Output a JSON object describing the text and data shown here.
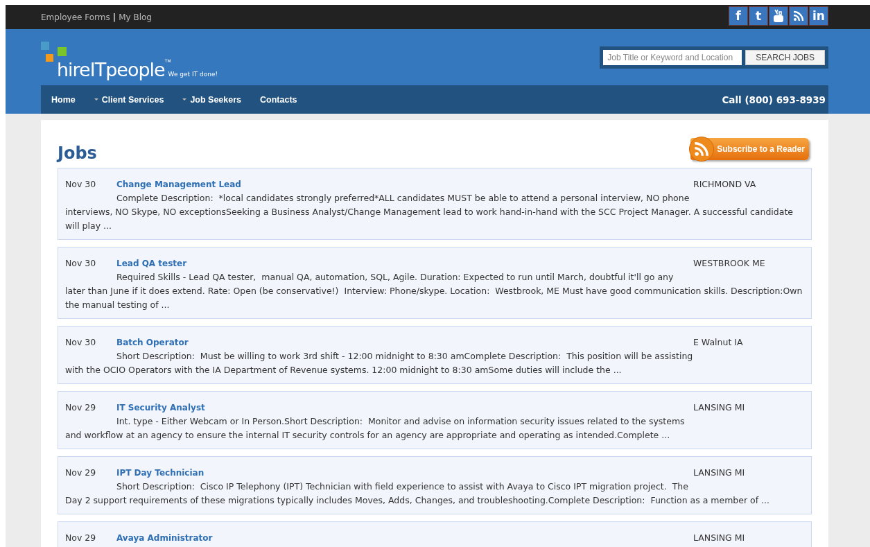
{
  "top_links": [
    {
      "label": "Employee Forms"
    },
    {
      "label": "My Blog"
    }
  ],
  "top_separator": "|",
  "social": [
    {
      "kind": "facebook",
      "label": "f"
    },
    {
      "kind": "twitter",
      "label": "t"
    },
    {
      "kind": "youtube"
    },
    {
      "kind": "rss"
    },
    {
      "kind": "linkedin",
      "label": "in"
    }
  ],
  "logo": {
    "name": "hireITpeople",
    "trademark": "TM",
    "tagline": "We get IT done!"
  },
  "search": {
    "placeholder": "Job Title or Keyword and Location",
    "button": "SEARCH JOBS"
  },
  "nav": [
    {
      "label": "Home",
      "dropdown": false
    },
    {
      "label": "Client Services",
      "dropdown": true
    },
    {
      "label": "Job Seekers",
      "dropdown": true
    },
    {
      "label": "Contacts",
      "dropdown": false
    }
  ],
  "phone": "Call (800) 693-8939",
  "page_title": "Jobs",
  "subscribe_button": "Subscribe to a Reader",
  "jobs": [
    {
      "date": "Nov 30",
      "title": "Change Management Lead",
      "location": "RICHMOND VA",
      "description": "Complete Description:  *local candidates strongly preferred*ALL candidates MUST be able to attend a personal interview, NO phone interviews, NO Skype, NO exceptionsSeeking a Business Analyst/Change Management lead to work hand-in-hand with the SCC Project Manager. A successful candidate will play ..."
    },
    {
      "date": "Nov 30",
      "title": "Lead QA tester",
      "location": "WESTBROOK ME",
      "description": "Required Skills - Lead QA tester,  manual QA, automation, SQL, Agile. Duration: Expected to run until March, doubtful it'll go any later than June if it does extend. Rate: Open (be conservative!)  Interview: Phone/skype. Location:  Westbrook, ME Must have good communication skills. Description:Own the manual testing of ..."
    },
    {
      "date": "Nov 30",
      "title": "Batch Operator",
      "location": "E Walnut IA",
      "description": "Short Description:  Must be willing to work 3rd shift - 12:00 midnight to 8:30 amComplete Description:  This position will be assisting with the OCIO Operators with the IA Department of Revenue systems. 12:00 midnight to 8:30 amSome duties will include the ..."
    },
    {
      "date": "Nov 29",
      "title": "IT Security Analyst",
      "location": "LANSING MI",
      "description": "Int. type - Either Webcam or In Person.Short Description:  Monitor and advise on information security issues related to the systems and workflow at an agency to ensure the internal IT security controls for an agency are appropriate and operating as intended.Complete ..."
    },
    {
      "date": "Nov 29",
      "title": "IPT Day Technician",
      "location": "LANSING MI",
      "description": "Short Description:  Cisco IP Telephony (IPT) Technician with field experience to assist with Avaya to Cisco IPT migration project.  The Day 2 support requirements of these migrations typically includes Moves, Adds, Changes, and troubleshooting.Complete Description:  Function as a member of ..."
    },
    {
      "date": "Nov 29",
      "title": "Avaya Administrator",
      "location": "LANSING MI"
    }
  ]
}
